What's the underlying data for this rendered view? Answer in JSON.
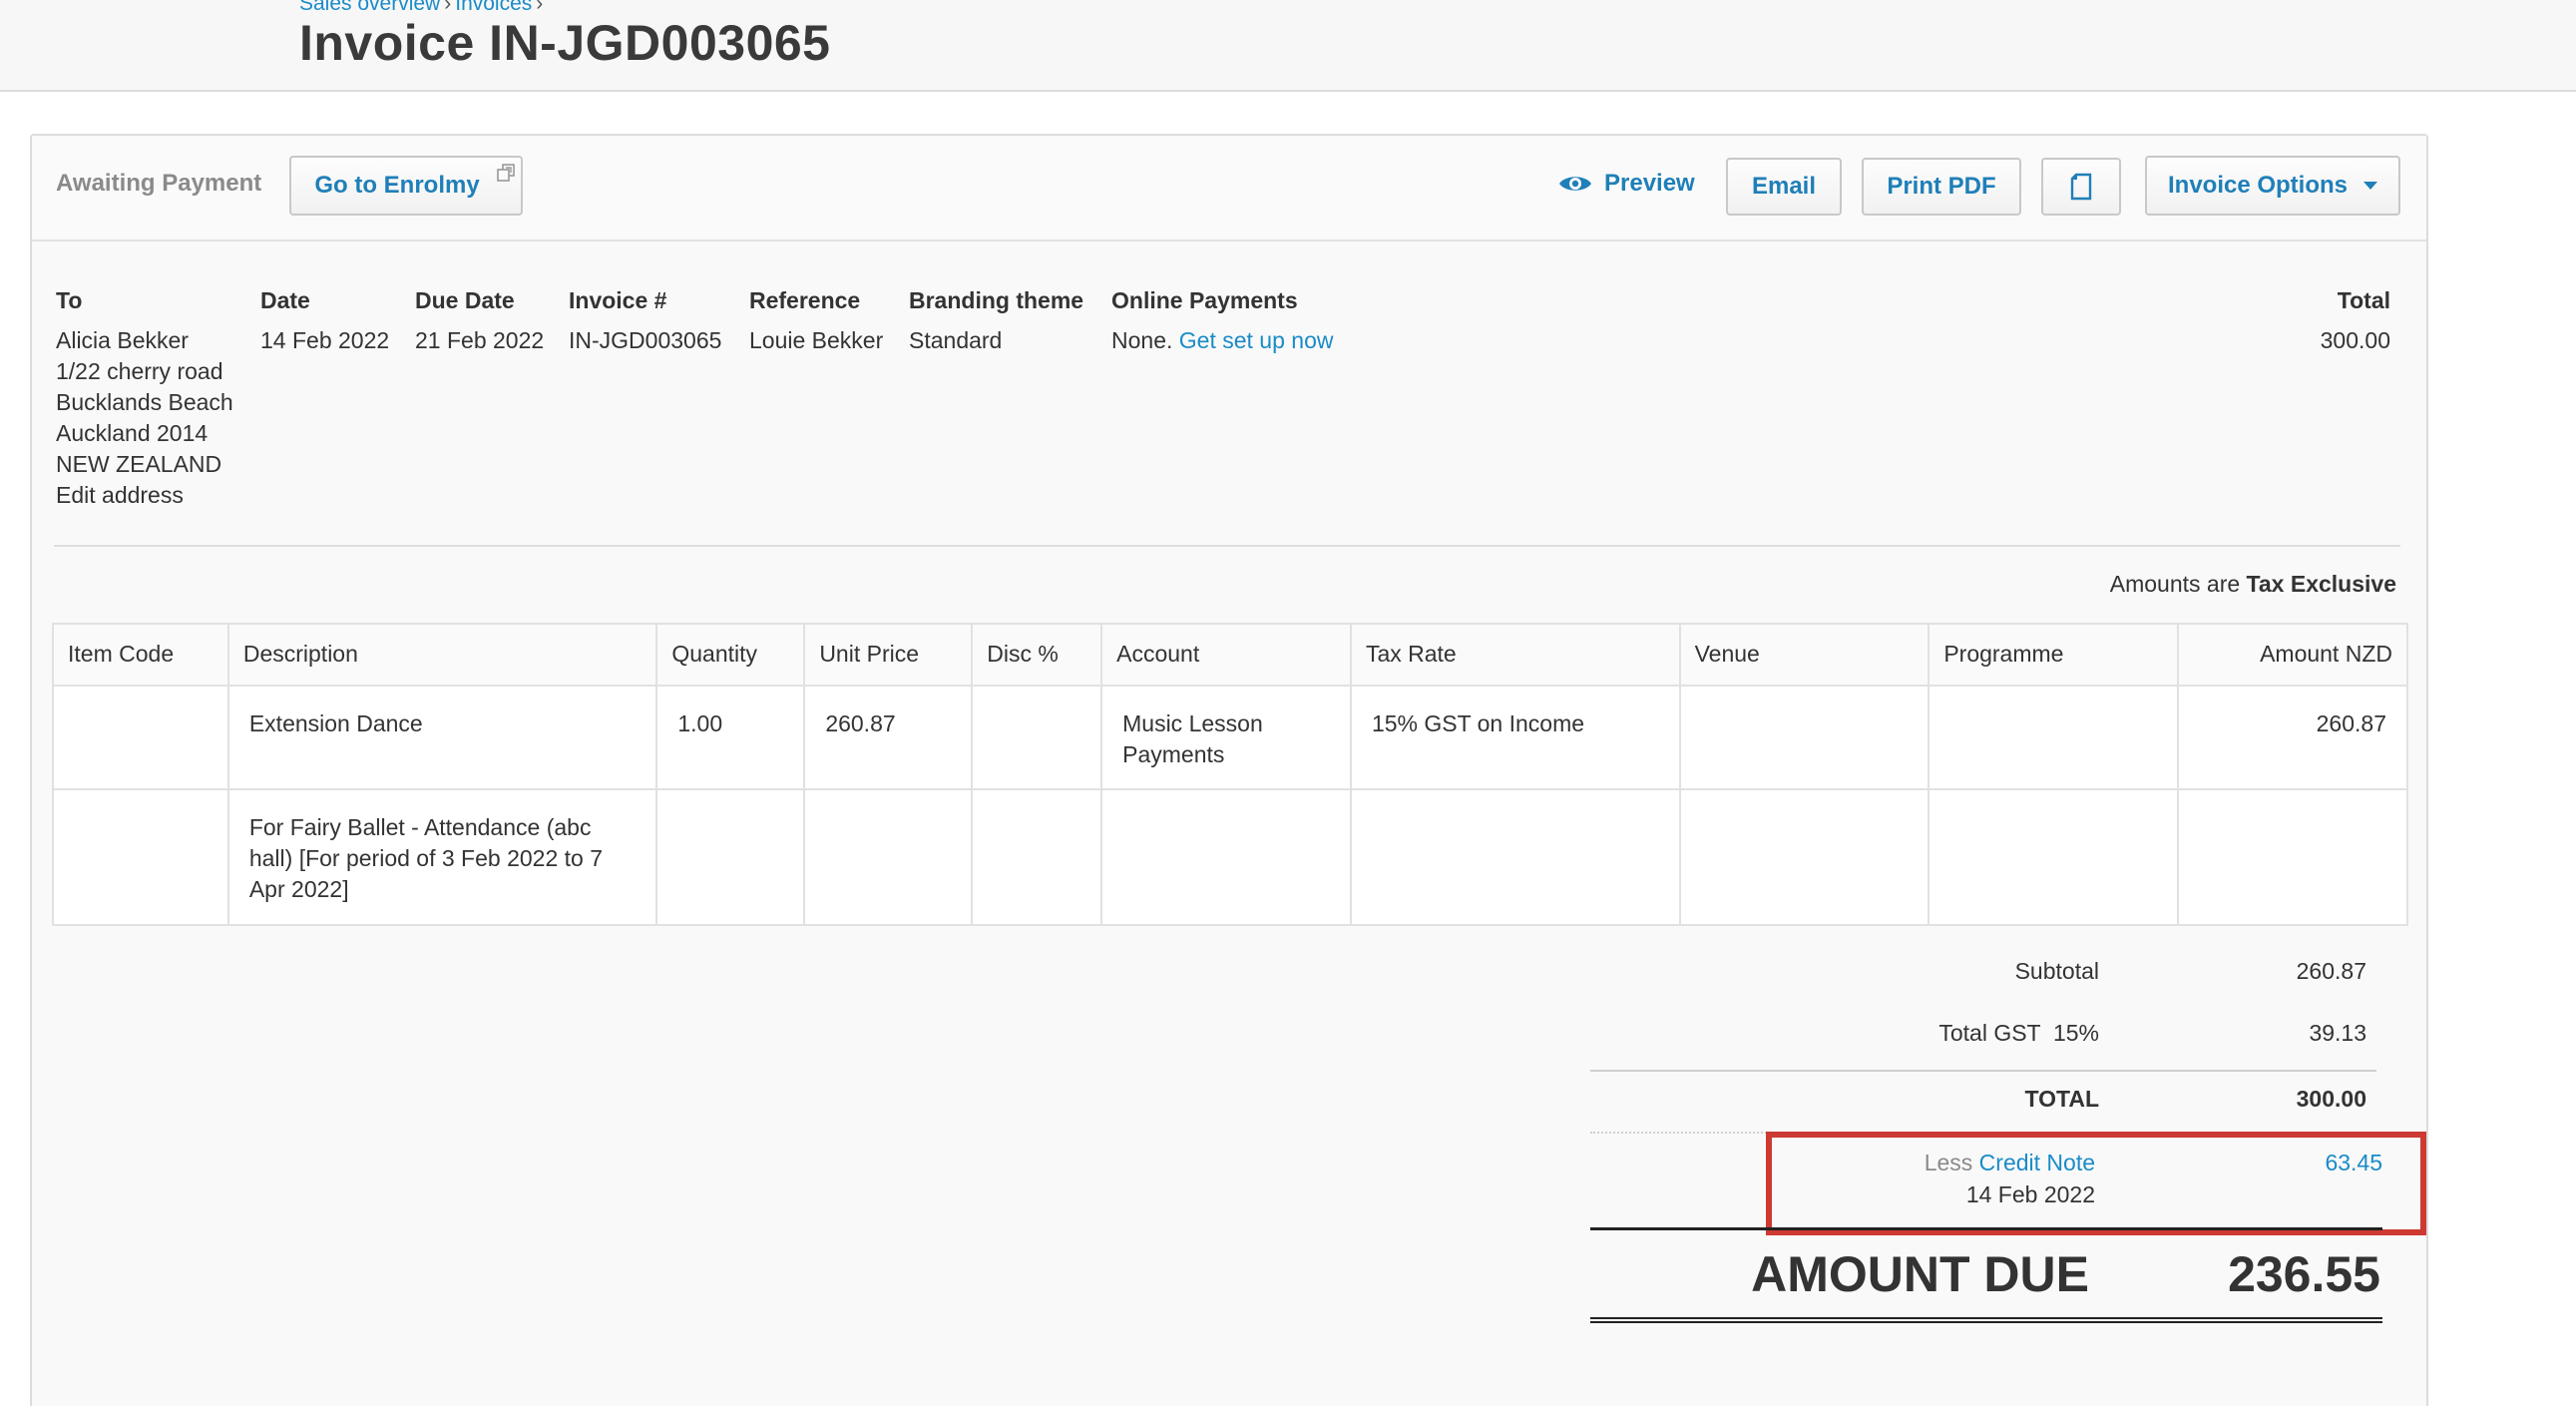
{
  "breadcrumb": {
    "item1": "Sales overview",
    "item2": "Invoices",
    "sep": "›"
  },
  "page": {
    "title": "Invoice IN-JGD003065"
  },
  "toolbar": {
    "status": "Awaiting Payment",
    "enrolmy_label": "Go to Enrolmy",
    "preview_label": "Preview",
    "email_label": "Email",
    "print_label": "Print PDF",
    "options_label": "Invoice Options"
  },
  "details": {
    "to_label": "To",
    "to_name": "Alicia Bekker",
    "address": [
      "1/22 cherry road",
      "Bucklands Beach",
      "Auckland 2014",
      "NEW ZEALAND"
    ],
    "edit_address": "Edit address",
    "date_label": "Date",
    "date": "14 Feb 2022",
    "due_label": "Due Date",
    "due": "21 Feb 2022",
    "invoice_label": "Invoice #",
    "invoice": "IN-JGD003065",
    "reference_label": "Reference",
    "reference": "Louie Bekker",
    "branding_label": "Branding theme",
    "branding": "Standard",
    "online_label": "Online Payments",
    "online_none": "None.",
    "online_link": "Get set up now",
    "total_label": "Total",
    "total": "300.00"
  },
  "tax": {
    "prefix": "Amounts are",
    "mode": "Tax Exclusive"
  },
  "items": {
    "headers": [
      "Item Code",
      "Description",
      "Quantity",
      "Unit Price",
      "Disc %",
      "Account",
      "Tax Rate",
      "Venue",
      "Programme",
      "Amount NZD"
    ],
    "rows": [
      [
        "",
        "Extension Dance",
        "1.00",
        "260.87",
        "",
        "Music Lesson Payments",
        "15% GST on Income",
        "",
        "",
        "260.87"
      ],
      [
        "",
        "For Fairy Ballet - Attendance (abc hall) [For period of 3 Feb 2022 to 7 Apr 2022]",
        "",
        "",
        "",
        "",
        "",
        "",
        "",
        ""
      ]
    ]
  },
  "totals": {
    "subtotal_label": "Subtotal",
    "subtotal": "260.87",
    "gst_label": "Total GST  15%",
    "gst": "39.13",
    "total_label": "TOTAL",
    "total": "300.00",
    "less_label": "Less",
    "credit_link": "Credit Note",
    "credit_date": "14 Feb 2022",
    "credit_amount": "63.45",
    "due_label": "AMOUNT DUE",
    "due": "236.55"
  },
  "colors": {
    "link": "#1a8bc8",
    "highlight": "#cc3a32"
  }
}
